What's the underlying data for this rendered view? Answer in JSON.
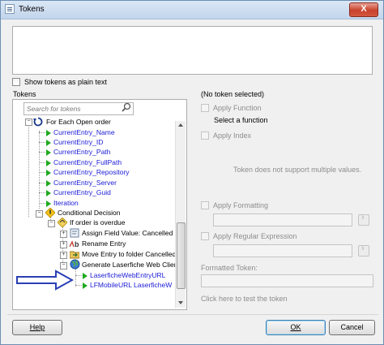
{
  "window": {
    "title": "Tokens",
    "close_label": "X"
  },
  "show_plain_text": {
    "label": "Show tokens as plain text",
    "checked": false
  },
  "tokens_panel": {
    "label": "Tokens",
    "search_placeholder": "Search for tokens",
    "tree": [
      {
        "label": "For Each Open order",
        "kind": "loop"
      },
      {
        "label": "CurrentEntry_Name",
        "kind": "token"
      },
      {
        "label": "CurrentEntry_ID",
        "kind": "token"
      },
      {
        "label": "CurrentEntry_Path",
        "kind": "token"
      },
      {
        "label": "CurrentEntry_FullPath",
        "kind": "token"
      },
      {
        "label": "CurrentEntry_Repository",
        "kind": "token"
      },
      {
        "label": "CurrentEntry_Server",
        "kind": "token"
      },
      {
        "label": "CurrentEntry_Guid",
        "kind": "token"
      },
      {
        "label": "Iteration",
        "kind": "token"
      },
      {
        "label": "Conditional Decision",
        "kind": "decision"
      },
      {
        "label": "If order is overdue",
        "kind": "branch"
      },
      {
        "label": "Assign Field Value: Cancelled",
        "kind": "activity"
      },
      {
        "label": "Rename Entry",
        "kind": "activity"
      },
      {
        "label": "Move Entry to folder Cancelled",
        "kind": "activity"
      },
      {
        "label": "Generate Laserfiche Web Client",
        "kind": "activity"
      },
      {
        "label": "LaserficheWebEntryURL",
        "kind": "token"
      },
      {
        "label": "LFMobileURL LaserficheW",
        "kind": "token"
      }
    ]
  },
  "details_panel": {
    "heading": "(No token selected)",
    "apply_function": "Apply Function",
    "select_function": "Select a function",
    "apply_index": "Apply Index",
    "multiple_values_note": "Token does not support multiple values.",
    "apply_formatting": "Apply Formatting",
    "apply_regex": "Apply Regular Expression",
    "formatted_token_label": "Formatted Token:",
    "test_link": "Click here to test the token"
  },
  "buttons": {
    "help": "Help",
    "ok": "OK",
    "cancel": "Cancel"
  },
  "colors": {
    "token_text": "#1a1ad8",
    "annotation_arrow": "#2a3fb5"
  }
}
